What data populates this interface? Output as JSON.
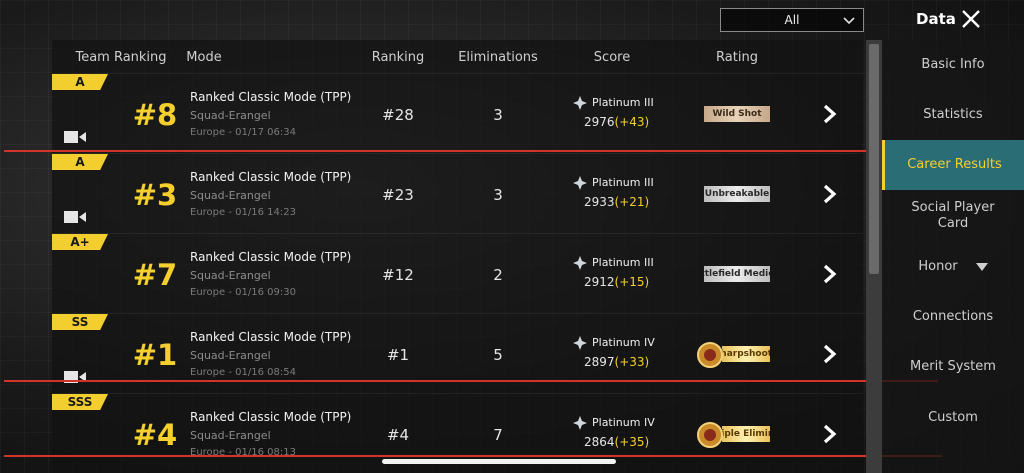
{
  "filter": {
    "value": "All"
  },
  "title": "Data",
  "table": {
    "headers": {
      "team_ranking": "Team Ranking",
      "mode": "Mode",
      "ranking": "Ranking",
      "eliminations": "Eliminations",
      "score": "Score",
      "rating": "Rating"
    },
    "rows": [
      {
        "grade": "A",
        "team_rank": "#8",
        "mode": "Ranked Classic Mode (TPP)",
        "map": "Squad-Erangel",
        "date": "Europe - 01/17 06:34",
        "ranking": "#28",
        "eliminations": "3",
        "tier": "Platinum III",
        "score": "2976",
        "delta": "(+43)",
        "rating": "Wild Shot"
      },
      {
        "grade": "A",
        "team_rank": "#3",
        "mode": "Ranked Classic Mode (TPP)",
        "map": "Squad-Erangel",
        "date": "Europe - 01/16 14:23",
        "ranking": "#23",
        "eliminations": "3",
        "tier": "Platinum III",
        "score": "2933",
        "delta": "(+21)",
        "rating": "Unbreakable"
      },
      {
        "grade": "A+",
        "team_rank": "#7",
        "mode": "Ranked Classic Mode (TPP)",
        "map": "Squad-Erangel",
        "date": "Europe - 01/16 09:30",
        "ranking": "#12",
        "eliminations": "2",
        "tier": "Platinum III",
        "score": "2912",
        "delta": "(+15)",
        "rating": "ttlefield Medic"
      },
      {
        "grade": "SS",
        "team_rank": "#1",
        "mode": "Ranked Classic Mode (TPP)",
        "map": "Squad-Erangel",
        "date": "Europe - 01/16 08:54",
        "ranking": "#1",
        "eliminations": "5",
        "tier": "Platinum IV",
        "score": "2897",
        "delta": "(+33)",
        "rating": "Sharpshoote"
      },
      {
        "grade": "SSS",
        "team_rank": "#4",
        "mode": "Ranked Classic Mode (TPP)",
        "map": "Squad-Erangel",
        "date": "Europe - 01/16 08:13",
        "ranking": "#4",
        "eliminations": "7",
        "tier": "Platinum IV",
        "score": "2864",
        "delta": "(+35)",
        "rating": "Triple Elimina"
      }
    ]
  },
  "sidebar": {
    "items": [
      {
        "label": "Basic Info"
      },
      {
        "label": "Statistics"
      },
      {
        "label": "Career Results"
      },
      {
        "label": "Social Player Card"
      },
      {
        "label": "Honor"
      },
      {
        "label": "Connections"
      },
      {
        "label": "Merit System"
      },
      {
        "label": "Custom"
      }
    ],
    "active_index": 2
  },
  "colors": {
    "accent_yellow": "#f5cf2e",
    "active_tab": "#2b6d74",
    "annotation_red": "#d3342a"
  }
}
